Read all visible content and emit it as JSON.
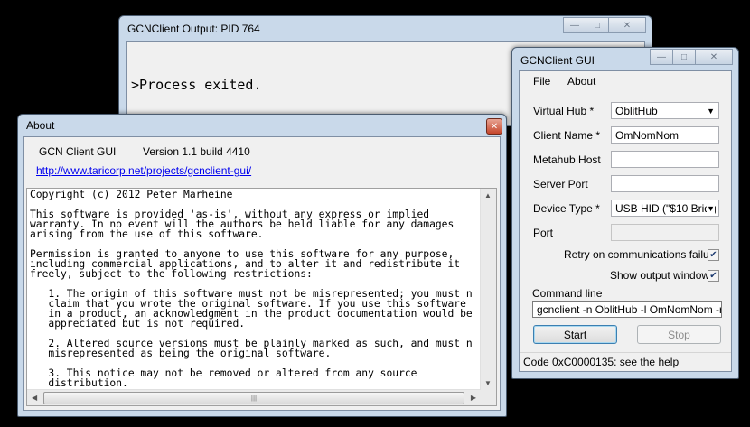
{
  "output_window": {
    "title": "GCNClient Output: PID 764",
    "content": ">Process exited."
  },
  "gui_window": {
    "title": "GCNClient GUI",
    "menu": [
      "File",
      "About"
    ],
    "fields": {
      "virtual_hub": {
        "label": "Virtual Hub *",
        "value": "OblitHub"
      },
      "client_name": {
        "label": "Client Name *",
        "value": "OmNomNom"
      },
      "metahub_host": {
        "label": "Metahub Host",
        "value": ""
      },
      "server_port": {
        "label": "Server Port",
        "value": ""
      },
      "device_type": {
        "label": "Device Type *",
        "value": "USB HID (\"$10 Bridg"
      },
      "port": {
        "label": "Port",
        "value": ""
      }
    },
    "retry_checkbox": {
      "label": "Retry on communications failure",
      "checked": true
    },
    "show_output_checkbox": {
      "label": "Show output window",
      "checked": true
    },
    "command_line": {
      "label": "Command line",
      "value": "gcnclient -n OblitHub -l OmNomNom -r -d us"
    },
    "start_label": "Start",
    "stop_label": "Stop",
    "status": "Code 0xC0000135: see the help"
  },
  "about_window": {
    "title": "About",
    "app_name": "GCN Client GUI",
    "version": "Version 1.1 build 4410",
    "link": "http://www.taricorp.net/projects/gcnclient-gui/",
    "license_text": "Copyright (c) 2012 Peter Marheine\n\nThis software is provided 'as-is', without any express or implied\nwarranty. In no event will the authors be held liable for any damages\narising from the use of this software.\n\nPermission is granted to anyone to use this software for any purpose,\nincluding commercial applications, and to alter it and redistribute it\nfreely, subject to the following restrictions:\n\n   1. The origin of this software must not be misrepresented; you must n\n   claim that you wrote the original software. If you use this software\n   in a product, an acknowledgment in the product documentation would be\n   appreciated but is not required.\n\n   2. Altered source versions must be plainly marked as such, and must n\n   misrepresented as being the original software.\n\n   3. This notice may not be removed or altered from any source\n   distribution."
  },
  "icons": [
    "minimize-icon",
    "maximize-icon",
    "close-icon",
    "dropdown-arrow-icon",
    "checkmark-icon",
    "scroll-up-icon",
    "scroll-down-icon",
    "scroll-left-icon",
    "scroll-right-icon"
  ]
}
